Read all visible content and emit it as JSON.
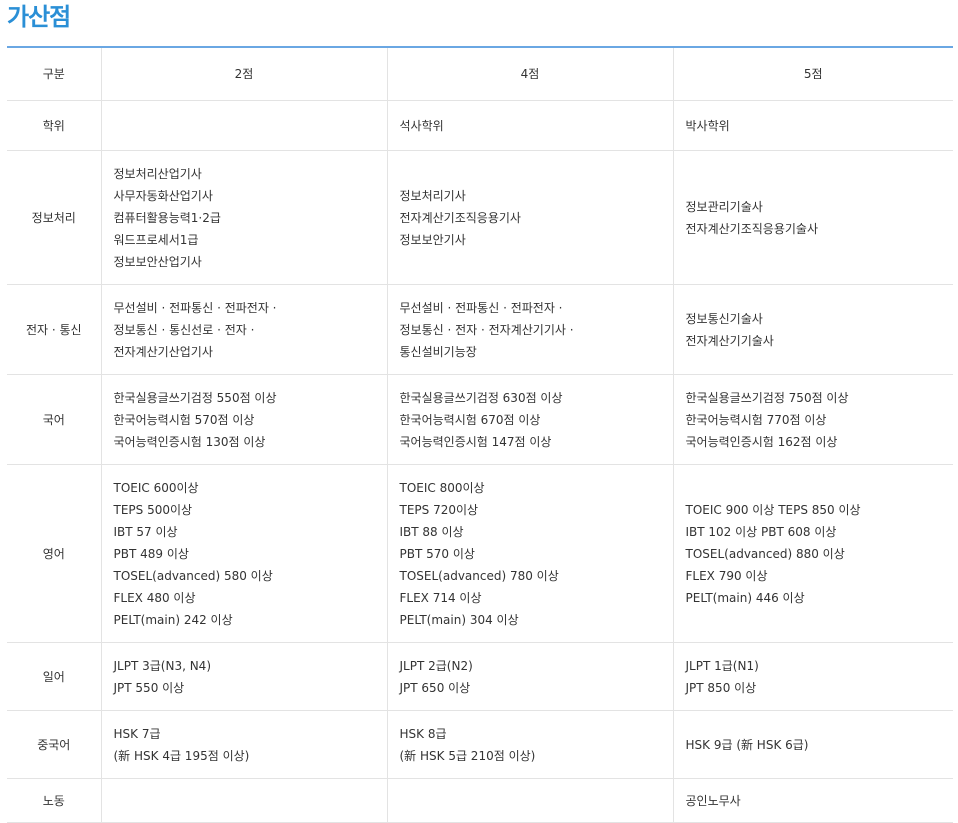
{
  "title": "가산점",
  "headers": [
    "구분",
    "2점",
    "4점",
    "5점"
  ],
  "rows": [
    {
      "category": "학위",
      "p2": [],
      "p4": [
        "석사학위"
      ],
      "p5": [
        "박사학위"
      ]
    },
    {
      "category": "정보처리",
      "p2": [
        "정보처리산업기사",
        "사무자동화산업기사",
        "컴퓨터활용능력1·2급",
        "워드프로세서1급",
        "정보보안산업기사"
      ],
      "p4": [
        "정보처리기사",
        "전자계산기조직응용기사",
        "정보보안기사"
      ],
      "p5": [
        "정보관리기술사",
        "전자계산기조직응용기술사"
      ]
    },
    {
      "category": "전자 · 통신",
      "p2": [
        "무선설비 · 전파통신 · 전파전자 ·",
        "정보통신 · 통신선로 · 전자 ·",
        "전자계산기산업기사"
      ],
      "p4": [
        "무선설비 · 전파통신 · 전파전자 ·",
        "정보통신 · 전자 · 전자계산기기사 ·",
        "통신설비기능장"
      ],
      "p5": [
        "정보통신기술사",
        "전자계산기기술사"
      ]
    },
    {
      "category": "국어",
      "p2": [
        "한국실용글쓰기검정 550점 이상",
        "한국어능력시험 570점 이상",
        "국어능력인증시험 130점 이상"
      ],
      "p4": [
        "한국실용글쓰기검정 630점 이상",
        "한국어능력시험 670점 이상",
        "국어능력인증시험 147점 이상"
      ],
      "p5": [
        "한국실용글쓰기검정 750점 이상",
        "한국어능력시험 770점 이상",
        "국어능력인증시험 162점 이상"
      ]
    },
    {
      "category": "영어",
      "p2": [
        "TOEIC 600이상",
        "TEPS 500이상",
        "IBT 57 이상",
        "PBT 489 이상",
        "TOSEL(advanced) 580 이상",
        "FLEX 480 이상",
        "PELT(main) 242 이상"
      ],
      "p4": [
        "TOEIC 800이상",
        "TEPS 720이상",
        "IBT 88 이상",
        "PBT 570 이상",
        "TOSEL(advanced) 780 이상",
        "FLEX 714 이상",
        "PELT(main) 304 이상"
      ],
      "p5": [
        "TOEIC 900 이상 TEPS 850 이상",
        "IBT 102 이상 PBT 608 이상",
        "TOSEL(advanced) 880 이상",
        "FLEX 790 이상",
        "PELT(main) 446 이상"
      ]
    },
    {
      "category": "일어",
      "p2": [
        "JLPT 3급(N3, N4)",
        "JPT 550 이상"
      ],
      "p4": [
        "JLPT 2급(N2)",
        "JPT 650 이상"
      ],
      "p5": [
        "JLPT 1급(N1)",
        "JPT 850 이상"
      ]
    },
    {
      "category": "중국어",
      "p2": [
        "HSK 7급",
        "(新 HSK 4급 195점 이상)"
      ],
      "p4": [
        "HSK 8급",
        "(新 HSK 5급 210점 이상)"
      ],
      "p5": [
        "HSK 9급 (新 HSK 6급)"
      ]
    },
    {
      "category": "노동",
      "p2": [],
      "p4": [],
      "p5": [
        "공인노무사"
      ]
    }
  ]
}
